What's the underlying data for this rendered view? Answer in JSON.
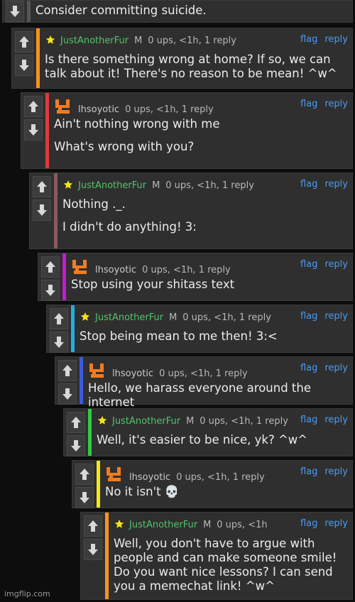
{
  "top": {
    "text": "Consider committing suicide."
  },
  "links": {
    "flag": "flag",
    "reply": "reply"
  },
  "comments": [
    {
      "user": "JustAnotherFur",
      "mod": "M",
      "stats": "0 ups, <1h, 1 reply",
      "lines": [
        "Is there something wrong at home? If so, we can talk about it! There's no reason to be mean! ^w^"
      ]
    },
    {
      "user": "lhsoyotic",
      "stats": "0 ups, <1h, 1 reply",
      "lines": [
        "Ain't nothing wrong with me",
        "What's wrong with you?"
      ]
    },
    {
      "user": "JustAnotherFur",
      "mod": "M",
      "stats": "0 ups, <1h, 1 reply",
      "lines": [
        "Nothing ._.",
        "I didn't do anything! 3:"
      ]
    },
    {
      "user": "lhsoyotic",
      "stats": "0 ups, <1h, 1 reply",
      "lines": [
        "Stop using your shitass text"
      ]
    },
    {
      "user": "JustAnotherFur",
      "mod": "M",
      "stats": "0 ups, <1h, 1 reply",
      "lines": [
        "Stop being mean to me then! 3:<"
      ]
    },
    {
      "user": "lhsoyotic",
      "stats": "0 ups, <1h, 1 reply",
      "lines": [
        "Hello, we harass everyone around the internet"
      ]
    },
    {
      "user": "JustAnotherFur",
      "mod": "M",
      "stats": "0 ups, <1h, 1 reply",
      "lines": [
        "Well, it's easier to be nice, yk? ^w^"
      ]
    },
    {
      "user": "lhsoyotic",
      "stats": "0 ups, <1h, 1 reply",
      "lines": [
        "No it isn't 💀"
      ]
    },
    {
      "user": "JustAnotherFur",
      "mod": "M",
      "stats": "0 ups, <1h",
      "lines": [
        "Well, you don't have to argue with people and can make someone smile! Do you want nice lessons? I can send you a memechat link! ^w^"
      ]
    }
  ],
  "colors": {
    "bars": [
      "#f7931e",
      "#e03a3a",
      "#8a5a5a",
      "#c21bd0",
      "#1eb0e0",
      "#3b5bdc",
      "#2ecc40",
      "#f5e61a",
      "#f7931e"
    ]
  },
  "watermark": "imgflip.com"
}
